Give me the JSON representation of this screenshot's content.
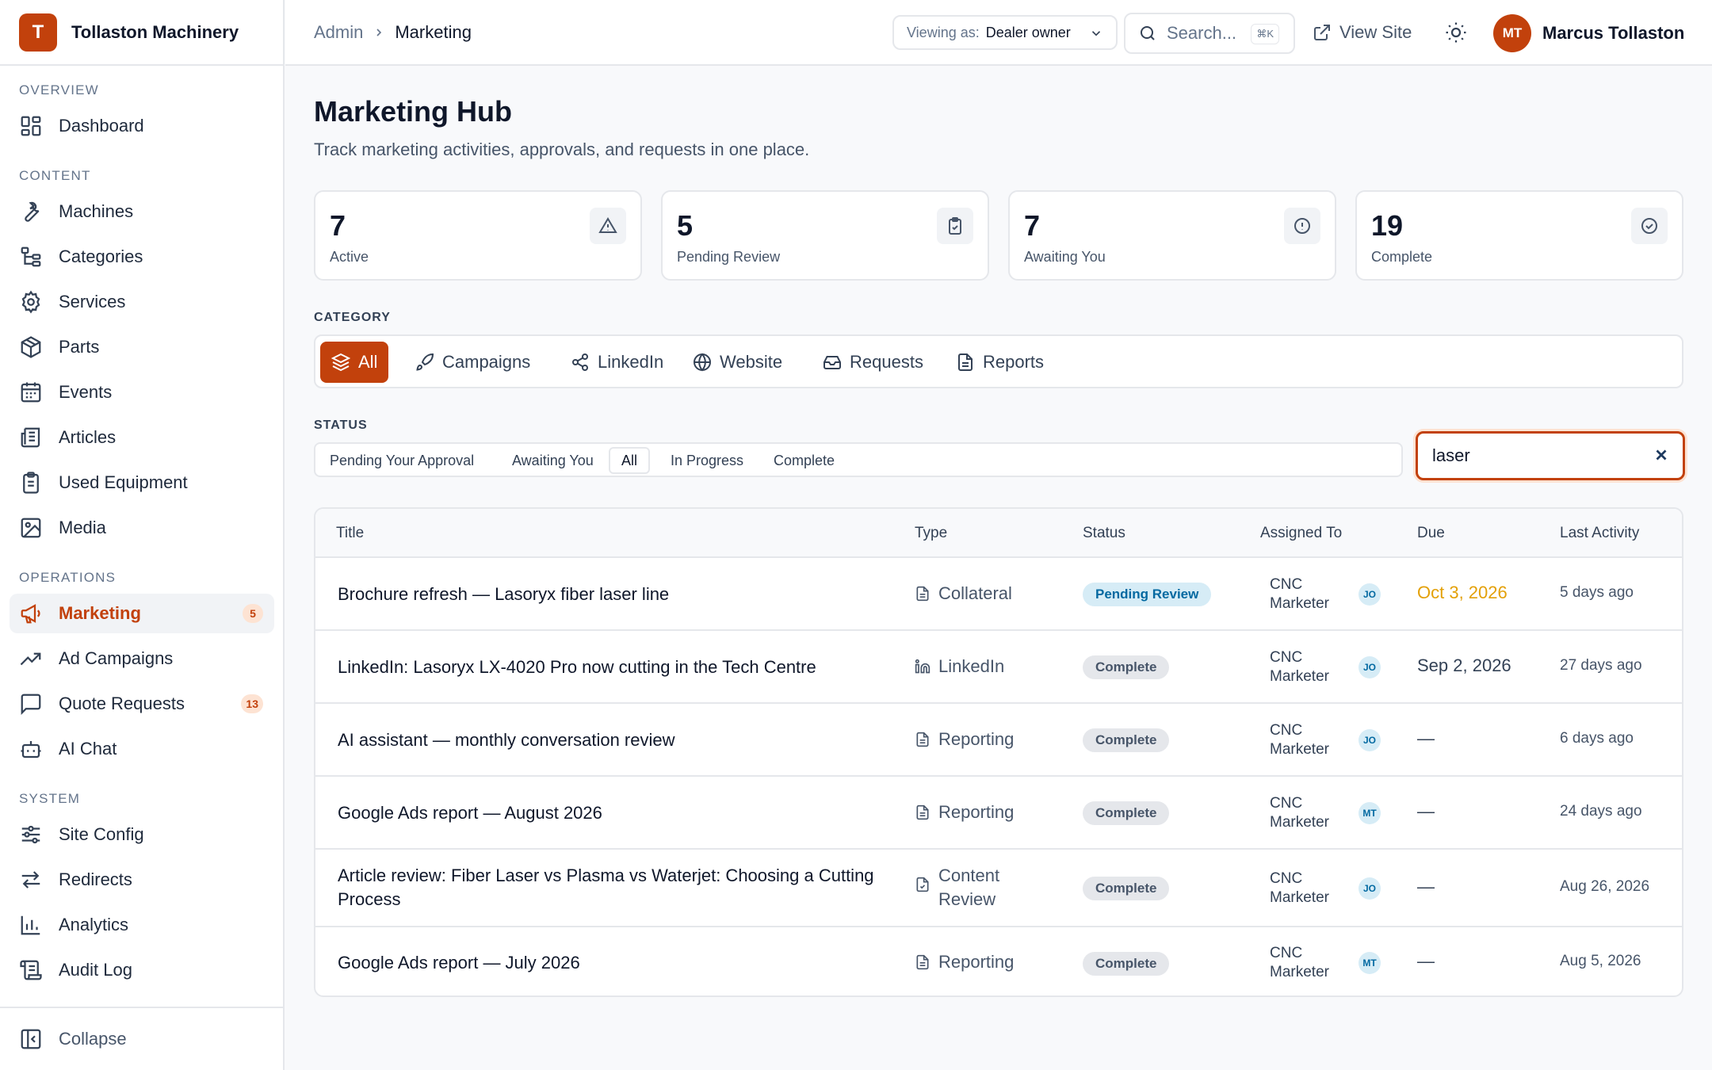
{
  "brand": {
    "logo_letter": "T",
    "name": "Tollaston Machinery",
    "color": "#c2410c"
  },
  "sidebar": {
    "sections": [
      {
        "label": "OVERVIEW"
      },
      {
        "label": "CONTENT"
      },
      {
        "label": "OPERATIONS"
      },
      {
        "label": "SYSTEM"
      }
    ],
    "items": [
      {
        "label": "Dashboard",
        "icon": "dashboard-icon"
      },
      {
        "label": "Machines",
        "icon": "wrench-icon"
      },
      {
        "label": "Categories",
        "icon": "tree-icon"
      },
      {
        "label": "Services",
        "icon": "gear-icon"
      },
      {
        "label": "Parts",
        "icon": "box-icon"
      },
      {
        "label": "Events",
        "icon": "calendar-icon"
      },
      {
        "label": "Articles",
        "icon": "newspaper-icon"
      },
      {
        "label": "Used Equipment",
        "icon": "clipboard-icon"
      },
      {
        "label": "Media",
        "icon": "image-icon"
      },
      {
        "label": "Marketing",
        "icon": "megaphone-icon",
        "badge": "5",
        "active": true
      },
      {
        "label": "Ad Campaigns",
        "icon": "trending-up-icon"
      },
      {
        "label": "Quote Requests",
        "icon": "message-icon",
        "badge": "13"
      },
      {
        "label": "AI Chat",
        "icon": "bot-icon"
      },
      {
        "label": "Site Config",
        "icon": "sliders-icon"
      },
      {
        "label": "Redirects",
        "icon": "redirect-icon"
      },
      {
        "label": "Analytics",
        "icon": "bar-chart-icon"
      },
      {
        "label": "Audit Log",
        "icon": "scroll-icon"
      }
    ],
    "collapse_label": "Collapse"
  },
  "header": {
    "breadcrumb": [
      "Admin",
      "Marketing"
    ],
    "viewing_label": "Viewing as:",
    "viewing_value": "Dealer owner",
    "search_placeholder": "Search...",
    "search_shortcut": "⌘K",
    "view_site": "View Site",
    "user_initials": "MT",
    "user_name": "Marcus Tollaston"
  },
  "page": {
    "title": "Marketing Hub",
    "subtitle": "Track marketing activities, approvals, and requests in one place."
  },
  "stats": [
    {
      "value": "7",
      "label": "Active",
      "icon": "alert-triangle-icon"
    },
    {
      "value": "5",
      "label": "Pending Review",
      "icon": "clipboard-check-icon"
    },
    {
      "value": "7",
      "label": "Awaiting You",
      "icon": "alert-circle-icon"
    },
    {
      "value": "19",
      "label": "Complete",
      "icon": "check-circle-icon"
    }
  ],
  "category": {
    "label": "CATEGORY",
    "tabs": [
      {
        "label": "All",
        "icon": "layers-icon",
        "active": true
      },
      {
        "label": "Campaigns",
        "icon": "rocket-icon"
      },
      {
        "label": "LinkedIn",
        "icon": "share-icon"
      },
      {
        "label": "Website",
        "icon": "globe-icon"
      },
      {
        "label": "Requests",
        "icon": "inbox-icon"
      },
      {
        "label": "Reports",
        "icon": "file-icon"
      }
    ]
  },
  "status": {
    "label": "STATUS",
    "tabs": [
      {
        "label": "Pending Your Approval"
      },
      {
        "label": "Awaiting You"
      },
      {
        "label": "All",
        "active": true
      },
      {
        "label": "In Progress"
      },
      {
        "label": "Complete"
      }
    ]
  },
  "filter": {
    "value": "laser"
  },
  "table": {
    "columns": [
      "Title",
      "Type",
      "Status",
      "Assigned To",
      "Due",
      "Last Activity"
    ],
    "rows": [
      {
        "title": "Brochure refresh — Lasoryx fiber laser line",
        "type": "Collateral",
        "type_icon": "file-icon",
        "status": "Pending Review",
        "assigned": "CNC Marketer",
        "avatar": "JO",
        "due": "Oct 3, 2026",
        "due_highlight": true,
        "last": "5 days ago"
      },
      {
        "title": "LinkedIn: Lasoryx LX-4020 Pro now cutting in the Tech Centre",
        "type": "LinkedIn",
        "type_icon": "linkedin-icon",
        "status": "Complete",
        "assigned": "CNC Marketer",
        "avatar": "JO",
        "due": "Sep 2, 2026",
        "last": "27 days ago"
      },
      {
        "title": "AI assistant — monthly conversation review",
        "type": "Reporting",
        "type_icon": "file-icon",
        "status": "Complete",
        "assigned": "CNC Marketer",
        "avatar": "JO",
        "due": "—",
        "last": "6 days ago"
      },
      {
        "title": "Google Ads report — August 2026",
        "type": "Reporting",
        "type_icon": "file-icon",
        "status": "Complete",
        "assigned": "CNC Marketer",
        "avatar": "MT",
        "due": "—",
        "last": "24 days ago"
      },
      {
        "title": "Article review: Fiber Laser vs Plasma vs Waterjet: Choosing a Cutting Process",
        "type": "Content Review",
        "type_icon": "file-check-icon",
        "status": "Complete",
        "assigned": "CNC Marketer",
        "avatar": "JO",
        "due": "—",
        "last": "Aug 26, 2026"
      },
      {
        "title": "Google Ads report — July 2026",
        "type": "Reporting",
        "type_icon": "file-icon",
        "status": "Complete",
        "assigned": "CNC Marketer",
        "avatar": "MT",
        "due": "—",
        "last": "Aug 5, 2026"
      }
    ]
  }
}
